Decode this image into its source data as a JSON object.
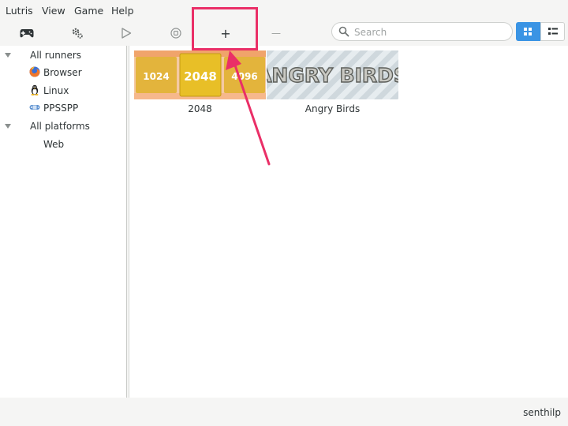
{
  "menu": [
    "Lutris",
    "View",
    "Game",
    "Help"
  ],
  "toolbar": {
    "gamepad_icon": "gamepad-icon",
    "settings_icon": "settings-gear-icon",
    "play_icon": "play-icon",
    "stop_icon": "stop-icon",
    "add_icon": "+",
    "remove_icon": "—"
  },
  "search": {
    "placeholder": "Search",
    "value": ""
  },
  "view_toggle": {
    "active": "grid"
  },
  "sidebar": {
    "runners_header": "All runners",
    "runners": [
      {
        "label": "Browser",
        "icon": "firefox-icon"
      },
      {
        "label": "Linux",
        "icon": "tux-icon"
      },
      {
        "label": "PPSSPP",
        "icon": "ppsspp-icon"
      }
    ],
    "platforms_header": "All platforms",
    "platforms": [
      {
        "label": "Web"
      }
    ]
  },
  "games": [
    {
      "name": "2048",
      "banner": {
        "tiles": [
          "1024",
          "2048",
          "4096"
        ],
        "colors": [
          "#e8bf27",
          "#f2b179",
          "#f9d9c2"
        ]
      }
    },
    {
      "name": "Angry Birds",
      "banner": {
        "text": "ANGRY BIRDS",
        "colors": [
          "#dfe6ea",
          "#c2ccd2"
        ]
      }
    }
  ],
  "status": {
    "user": "senthilp"
  },
  "annotation": {
    "color": "#ea2f67"
  }
}
